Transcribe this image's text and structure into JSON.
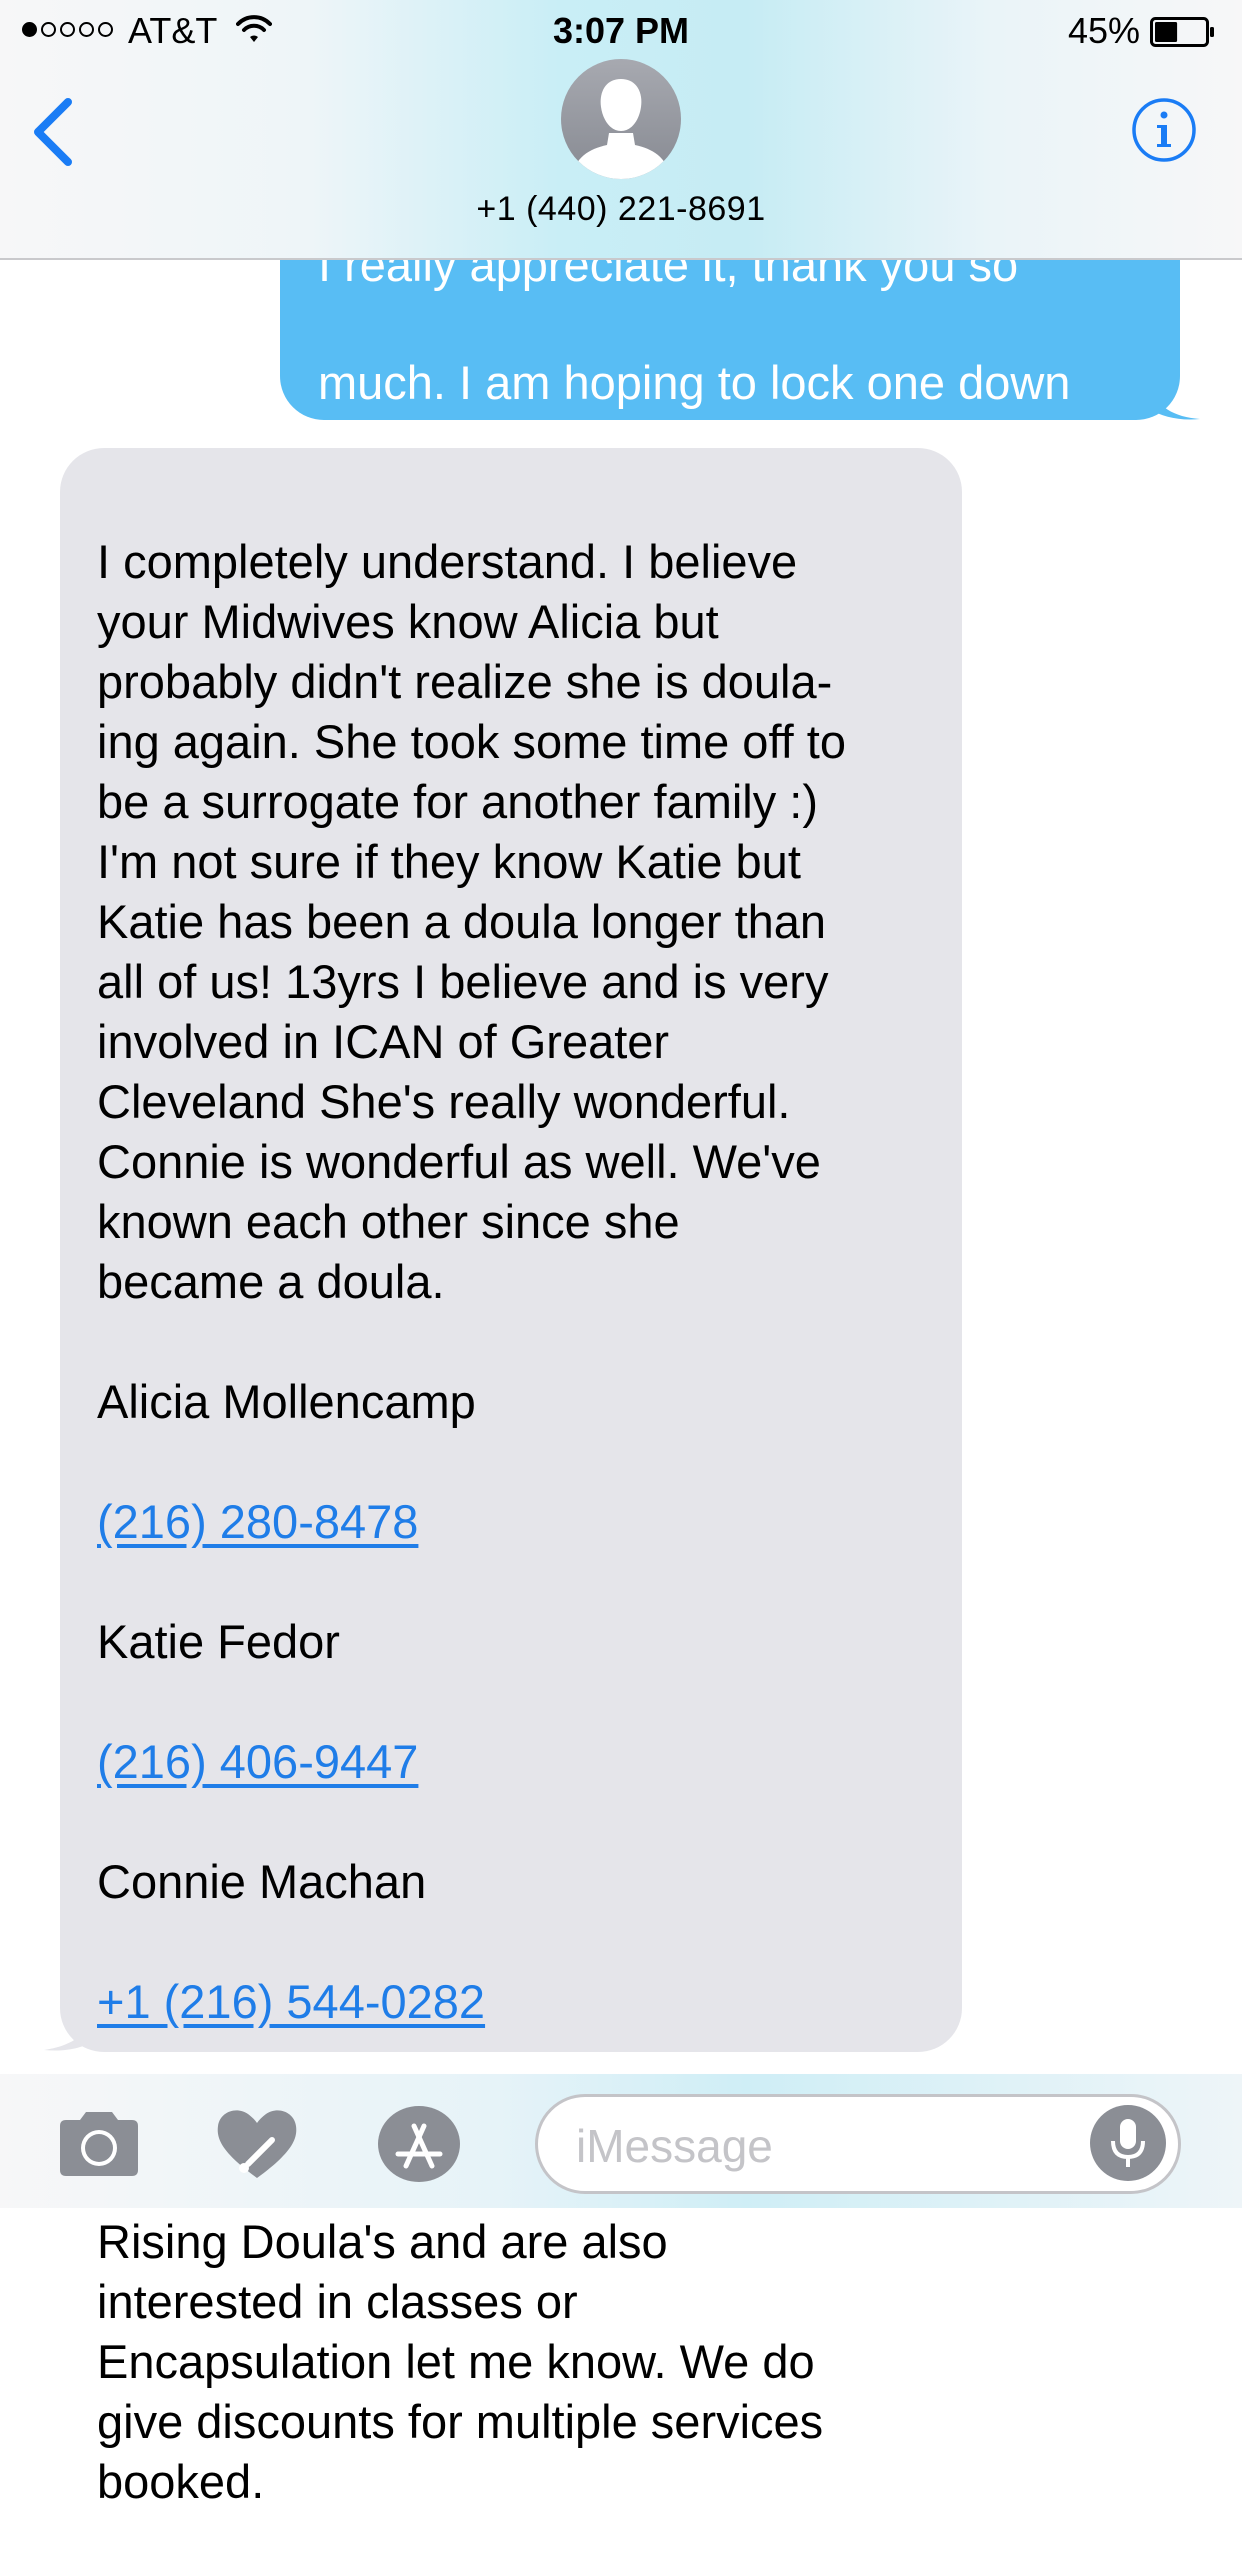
{
  "status_bar": {
    "carrier": "AT&T",
    "time": "3:07 PM",
    "battery_percent": "45%",
    "battery_level": 0.45,
    "signal_bars": 1,
    "signal_total": 5
  },
  "header": {
    "contact": "+1 (440) 221-8691",
    "back_icon": "chevron-left-icon",
    "info_icon": "info-icon",
    "avatar_icon": "person-silhouette"
  },
  "messages": {
    "sent": {
      "clipped_line": "I really appreciate it, thank you so",
      "text": "much. I am hoping to lock one down\nasap before they are all booked up"
    },
    "received": {
      "body_1": "I completely understand. I believe\nyour Midwives know Alicia but\nprobably didn't realize she is doula-\ning again. She took some time off to\nbe a surrogate for another family :)\nI'm not sure if they know Katie but\nKatie has been a doula longer than\nall of us! 13yrs I believe and is very\ninvolved in ICAN of Greater\nCleveland She's really wonderful.\nConnie is wonderful as well. We've\nknown each other since she\nbecame a doula.",
      "contact_1_name": "Alicia Mollencamp",
      "contact_1_phone": "(216) 280-8478",
      "contact_2_name": "Katie Fedor",
      "contact_2_phone": "(216) 406-9447",
      "contact_3_name": "Connie Machan",
      "contact_3_phone": "+1 (216) 544-0282",
      "body_2": "If you or Jessica decide to go\nforward with one of the Mother\nRising Doula's and are also\ninterested in classes or\nEncapsulation let me know. We do\ngive discounts for multiple services\nbooked."
    }
  },
  "input_bar": {
    "placeholder": "iMessage",
    "icons": [
      "camera-icon",
      "digital-touch-heart-icon",
      "app-store-icon",
      "microphone-icon"
    ]
  },
  "colors": {
    "sent_bubble": "#58bdf4",
    "received_bubble": "#e5e5ea",
    "link": "#1f7de8",
    "ios_blue": "#1a7cf5"
  }
}
